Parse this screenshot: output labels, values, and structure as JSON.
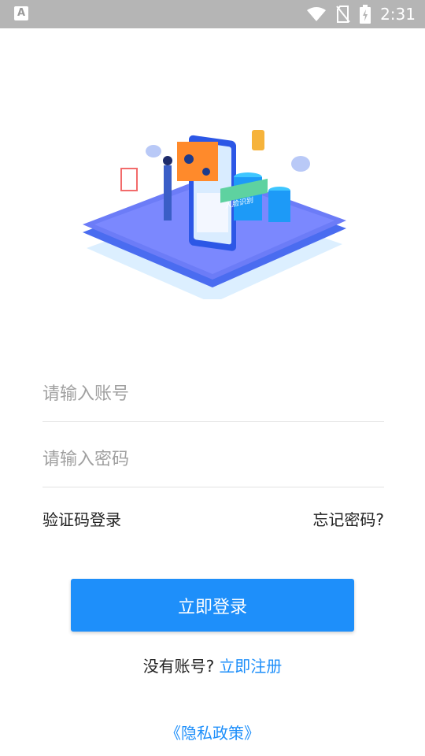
{
  "status_bar": {
    "time": "2:31",
    "app_icon_letter": "A",
    "icons": [
      "wifi-icon",
      "no-sim-icon",
      "battery-charging-icon"
    ]
  },
  "illustration": {
    "label": "人脸识别"
  },
  "login_form": {
    "account_placeholder": "请输入账号",
    "password_placeholder": "请输入密码",
    "sms_login_link": "验证码登录",
    "forgot_password_link": "忘记密码?",
    "login_button": "立即登录",
    "no_account_text": "没有账号?",
    "register_link": "立即注册",
    "privacy_link": "《隐私政策》"
  },
  "colors": {
    "accent": "#1e8ffa",
    "status_bar": "#b5b5b5"
  }
}
